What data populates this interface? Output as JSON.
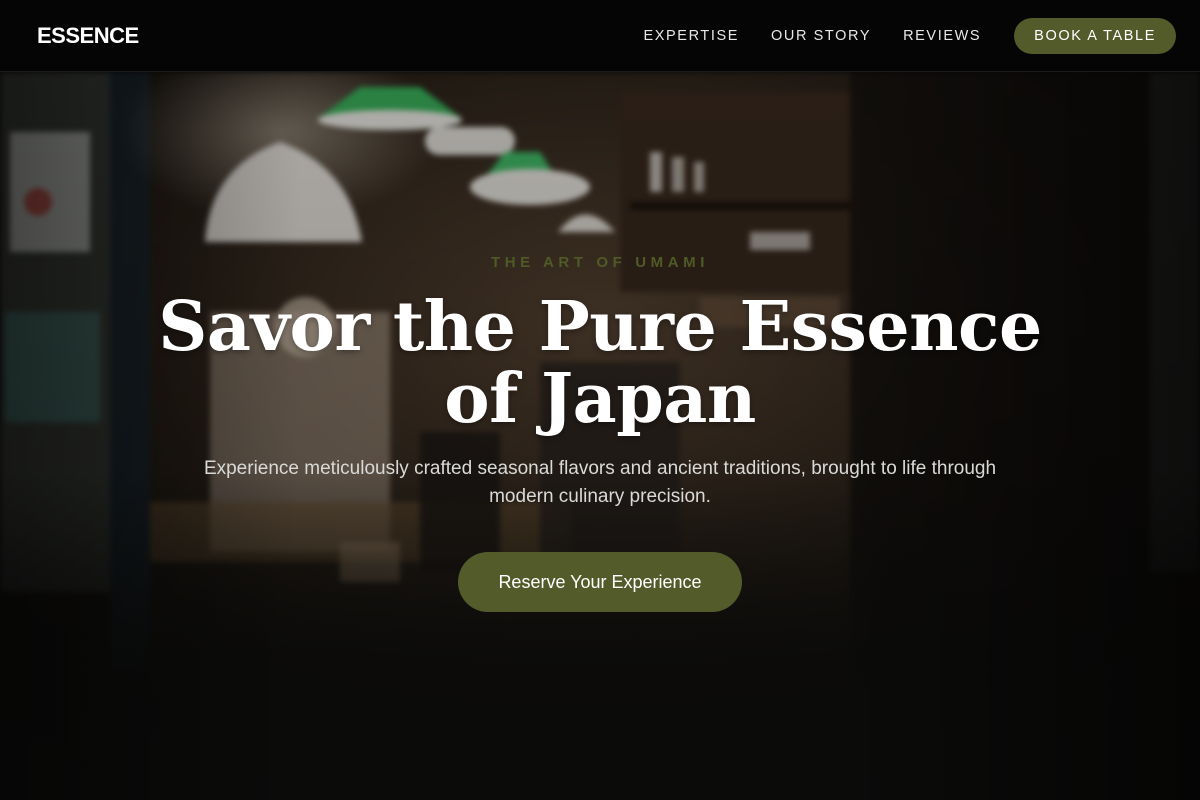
{
  "brand": {
    "logo": "ESSENCE"
  },
  "nav": {
    "links": [
      "EXPERTISE",
      "OUR STORY",
      "REVIEWS"
    ],
    "book_label": "BOOK A TABLE"
  },
  "hero": {
    "eyebrow": "THE ART OF UMAMI",
    "title": "Savor the Pure Essence of Japan",
    "subtitle": "Experience meticulously crafted seasonal flavors and ancient traditions, brought to life through modern culinary precision.",
    "cta_label": "Reserve Your Experience"
  },
  "colors": {
    "accent": "#545b2a",
    "eyebrow": "#4f5a26",
    "nav_bg": "#050505",
    "page_bg": "#0b0b0a"
  }
}
